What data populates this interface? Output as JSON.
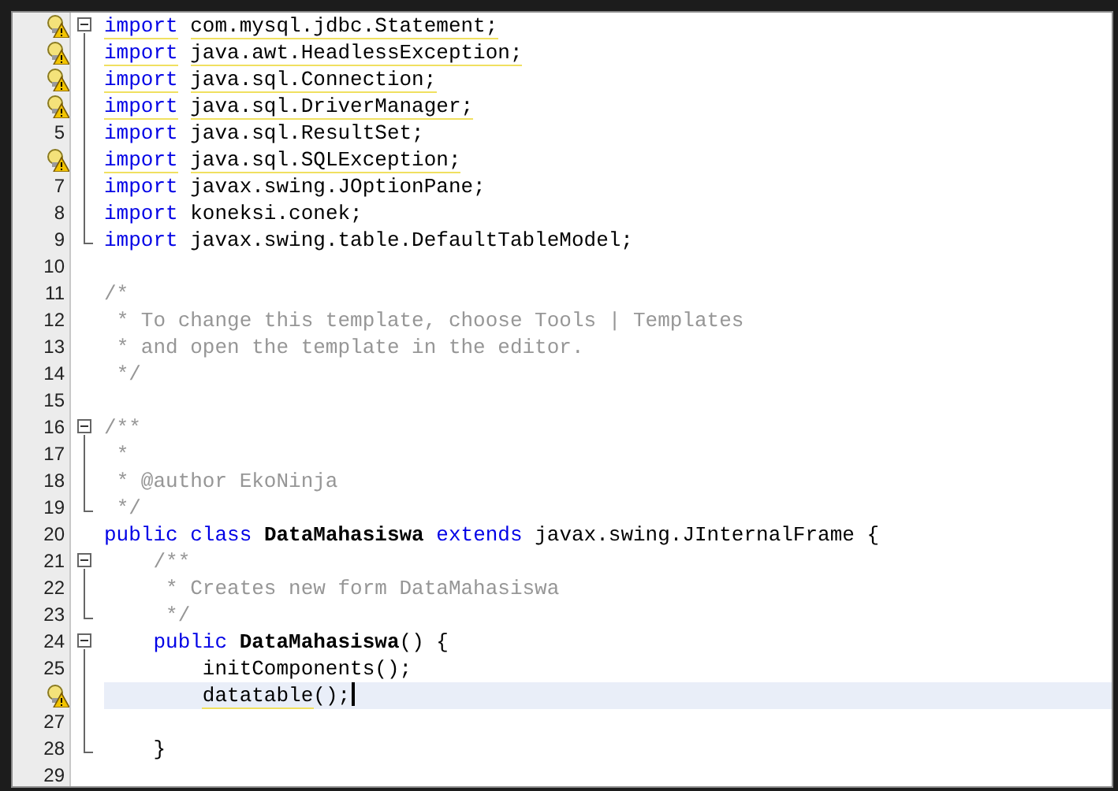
{
  "editor": {
    "lines": [
      {
        "hint": true,
        "fold_start": true,
        "tokens": [
          {
            "kind": "keyword",
            "text": "import",
            "warning": true
          },
          {
            "kind": "plain",
            "text": " com.mysql.jdbc.Statement;",
            "warning": true
          }
        ]
      },
      {
        "hint": true,
        "fold_line": true,
        "tokens": [
          {
            "kind": "keyword",
            "text": "import",
            "warning": true
          },
          {
            "kind": "plain",
            "text": " java.awt.HeadlessException;",
            "warning": true
          }
        ]
      },
      {
        "hint": true,
        "fold_line": true,
        "tokens": [
          {
            "kind": "keyword",
            "text": "import",
            "warning": true
          },
          {
            "kind": "plain",
            "text": " java.sql.Connection;",
            "warning": true
          }
        ]
      },
      {
        "hint": true,
        "fold_line": true,
        "tokens": [
          {
            "kind": "keyword",
            "text": "import",
            "warning": true
          },
          {
            "kind": "plain",
            "text": " java.sql.DriverManager;",
            "warning": true
          }
        ]
      },
      {
        "number": "5",
        "fold_line": true,
        "tokens": [
          {
            "kind": "keyword",
            "text": "import"
          },
          {
            "kind": "plain",
            "text": " java.sql.ResultSet;"
          }
        ]
      },
      {
        "hint": true,
        "fold_line": true,
        "tokens": [
          {
            "kind": "keyword",
            "text": "import",
            "warning": true
          },
          {
            "kind": "plain",
            "text": " java.sql.SQLException;",
            "warning": true
          }
        ]
      },
      {
        "number": "7",
        "fold_line": true,
        "tokens": [
          {
            "kind": "keyword",
            "text": "import"
          },
          {
            "kind": "plain",
            "text": " javax.swing.JOptionPane;"
          }
        ]
      },
      {
        "number": "8",
        "fold_line": true,
        "tokens": [
          {
            "kind": "keyword",
            "text": "import"
          },
          {
            "kind": "plain",
            "text": " koneksi.conek;"
          }
        ]
      },
      {
        "number": "9",
        "fold_end": true,
        "tokens": [
          {
            "kind": "keyword",
            "text": "import"
          },
          {
            "kind": "plain",
            "text": " javax.swing.table.DefaultTableModel;"
          }
        ]
      },
      {
        "number": "10"
      },
      {
        "number": "11",
        "tokens": [
          {
            "kind": "comment",
            "text": "/*"
          }
        ]
      },
      {
        "number": "12",
        "tokens": [
          {
            "kind": "comment",
            "text": " * To change this template, choose Tools | Templates"
          }
        ]
      },
      {
        "number": "13",
        "tokens": [
          {
            "kind": "comment",
            "text": " * and open the template in the editor."
          }
        ]
      },
      {
        "number": "14",
        "tokens": [
          {
            "kind": "comment",
            "text": " */"
          }
        ]
      },
      {
        "number": "15"
      },
      {
        "number": "16",
        "fold_start": true,
        "tokens": [
          {
            "kind": "comment",
            "text": "/**"
          }
        ]
      },
      {
        "number": "17",
        "fold_line": true,
        "tokens": [
          {
            "kind": "comment",
            "text": " *"
          }
        ]
      },
      {
        "number": "18",
        "fold_line": true,
        "tokens": [
          {
            "kind": "comment",
            "text": " * @author EkoNinja"
          }
        ]
      },
      {
        "number": "19",
        "fold_end": true,
        "tokens": [
          {
            "kind": "comment",
            "text": " */"
          }
        ]
      },
      {
        "number": "20",
        "tokens": [
          {
            "kind": "keyword",
            "text": "public class"
          },
          {
            "kind": "name",
            "text": " DataMahasiswa"
          },
          {
            "kind": "keyword",
            "text": " extends"
          },
          {
            "kind": "plain",
            "text": " javax.swing.JInternalFrame {"
          }
        ]
      },
      {
        "number": "21",
        "fold_start": true,
        "tokens": [
          {
            "kind": "comment",
            "text": "    /**"
          }
        ]
      },
      {
        "number": "22",
        "fold_line": true,
        "tokens": [
          {
            "kind": "comment",
            "text": "     * Creates new form DataMahasiswa"
          }
        ]
      },
      {
        "number": "23",
        "fold_end": true,
        "tokens": [
          {
            "kind": "comment",
            "text": "     */"
          }
        ]
      },
      {
        "number": "24",
        "fold_start": true,
        "tokens": [
          {
            "kind": "keyword",
            "text": "    public"
          },
          {
            "kind": "name",
            "text": " DataMahasiswa"
          },
          {
            "kind": "plain",
            "text": "() {"
          }
        ]
      },
      {
        "number": "25",
        "fold_line": true,
        "tokens": [
          {
            "kind": "plain",
            "text": "        initComponents();"
          }
        ]
      },
      {
        "hint": true,
        "fold_line": true,
        "current": true,
        "caret": true,
        "tokens": [
          {
            "kind": "plain",
            "text": "        datatable",
            "warning": true
          },
          {
            "kind": "plain",
            "text": "();"
          }
        ]
      },
      {
        "number": "27",
        "fold_line": true
      },
      {
        "number": "28",
        "fold_end": true,
        "tokens": [
          {
            "kind": "plain",
            "text": "    }"
          }
        ]
      },
      {
        "number": "29"
      }
    ]
  }
}
